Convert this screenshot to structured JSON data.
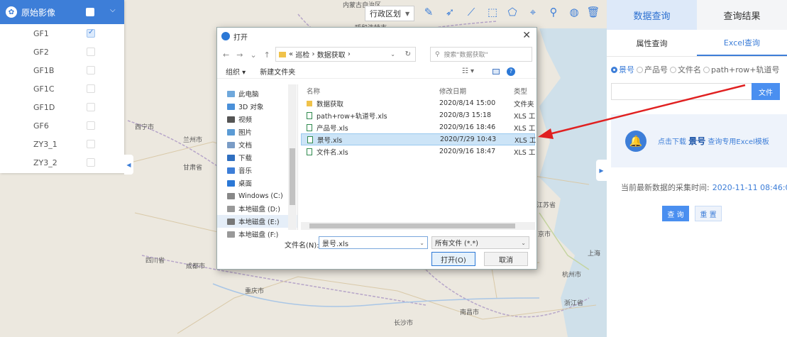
{
  "colors": {
    "accent": "#3d7ed8",
    "arrow": "#e02020"
  },
  "map": {
    "labels": [
      "内蒙古自治区",
      "呼和浩特市",
      "西宁市",
      "兰州市",
      "甘肃省",
      "四川省",
      "成都市",
      "重庆市",
      "长沙市",
      "南昌市",
      "杭州市",
      "浙江省",
      "上海",
      "京市",
      "江苏省"
    ]
  },
  "layer_panel": {
    "title": "原始影像",
    "items": [
      {
        "label": "GF1",
        "checked": true
      },
      {
        "label": "GF2",
        "checked": false
      },
      {
        "label": "GF1B",
        "checked": false
      },
      {
        "label": "GF1C",
        "checked": false
      },
      {
        "label": "GF1D",
        "checked": false
      },
      {
        "label": "GF6",
        "checked": false
      },
      {
        "label": "ZY3_1",
        "checked": false
      },
      {
        "label": "ZY3_2",
        "checked": false
      }
    ]
  },
  "toolbar": {
    "region_label": "行政区划",
    "tools": [
      "edit-icon",
      "pointer-icon",
      "polyline-icon",
      "rectangle-select-icon",
      "polygon-icon",
      "locate-icon",
      "pin-icon",
      "globe-icon",
      "trash-icon"
    ]
  },
  "right_panel": {
    "tabs": [
      "数据查询",
      "查询结果"
    ],
    "sub_tabs": [
      "属性查询",
      "Excel查询"
    ],
    "radios": [
      "景号",
      "产品号",
      "文件名",
      "path+row+轨道号"
    ],
    "file_button": "文件",
    "notice_prefix": "点击下载",
    "notice_key": "景号",
    "notice_suffix": "查询专用Excel模板",
    "latest_label": "当前最新数据的采集时间:",
    "latest_time": "2020-11-11 08:46:04",
    "query_button": "查 询",
    "reset_button": "重 置"
  },
  "dialog": {
    "title": "打开",
    "path_parts": [
      "«",
      "巡检",
      "›",
      "数据获取",
      "›"
    ],
    "search_placeholder": "搜索\"数据获取\"",
    "organize": "组织 ▾",
    "new_folder": "新建文件夹",
    "nav_items": [
      "此电脑",
      "3D 对象",
      "视频",
      "图片",
      "文档",
      "下载",
      "音乐",
      "桌面",
      "Windows (C:)",
      "本地磁盘 (D:)",
      "本地磁盘 (E:)",
      "本地磁盘 (F:)"
    ],
    "columns": {
      "name": "名称",
      "date": "修改日期",
      "type": "类型"
    },
    "files": [
      {
        "name": "数据获取",
        "date": "2020/8/14 15:00",
        "type": "文件夹",
        "folder": true
      },
      {
        "name": "path+row+轨道号.xls",
        "date": "2020/8/3 15:18",
        "type": "XLS 工",
        "folder": false
      },
      {
        "name": "产品号.xls",
        "date": "2020/9/16 18:46",
        "type": "XLS 工",
        "folder": false
      },
      {
        "name": "景号.xls",
        "date": "2020/7/29 10:43",
        "type": "XLS 工",
        "folder": false,
        "selected": true
      },
      {
        "name": "文件名.xls",
        "date": "2020/9/16 18:47",
        "type": "XLS 工",
        "folder": false
      }
    ],
    "filename_label": "文件名(N):",
    "filename_value": "景号.xls",
    "filetype_value": "所有文件 (*.*)",
    "open_button": "打开(O)",
    "cancel_button": "取消"
  }
}
